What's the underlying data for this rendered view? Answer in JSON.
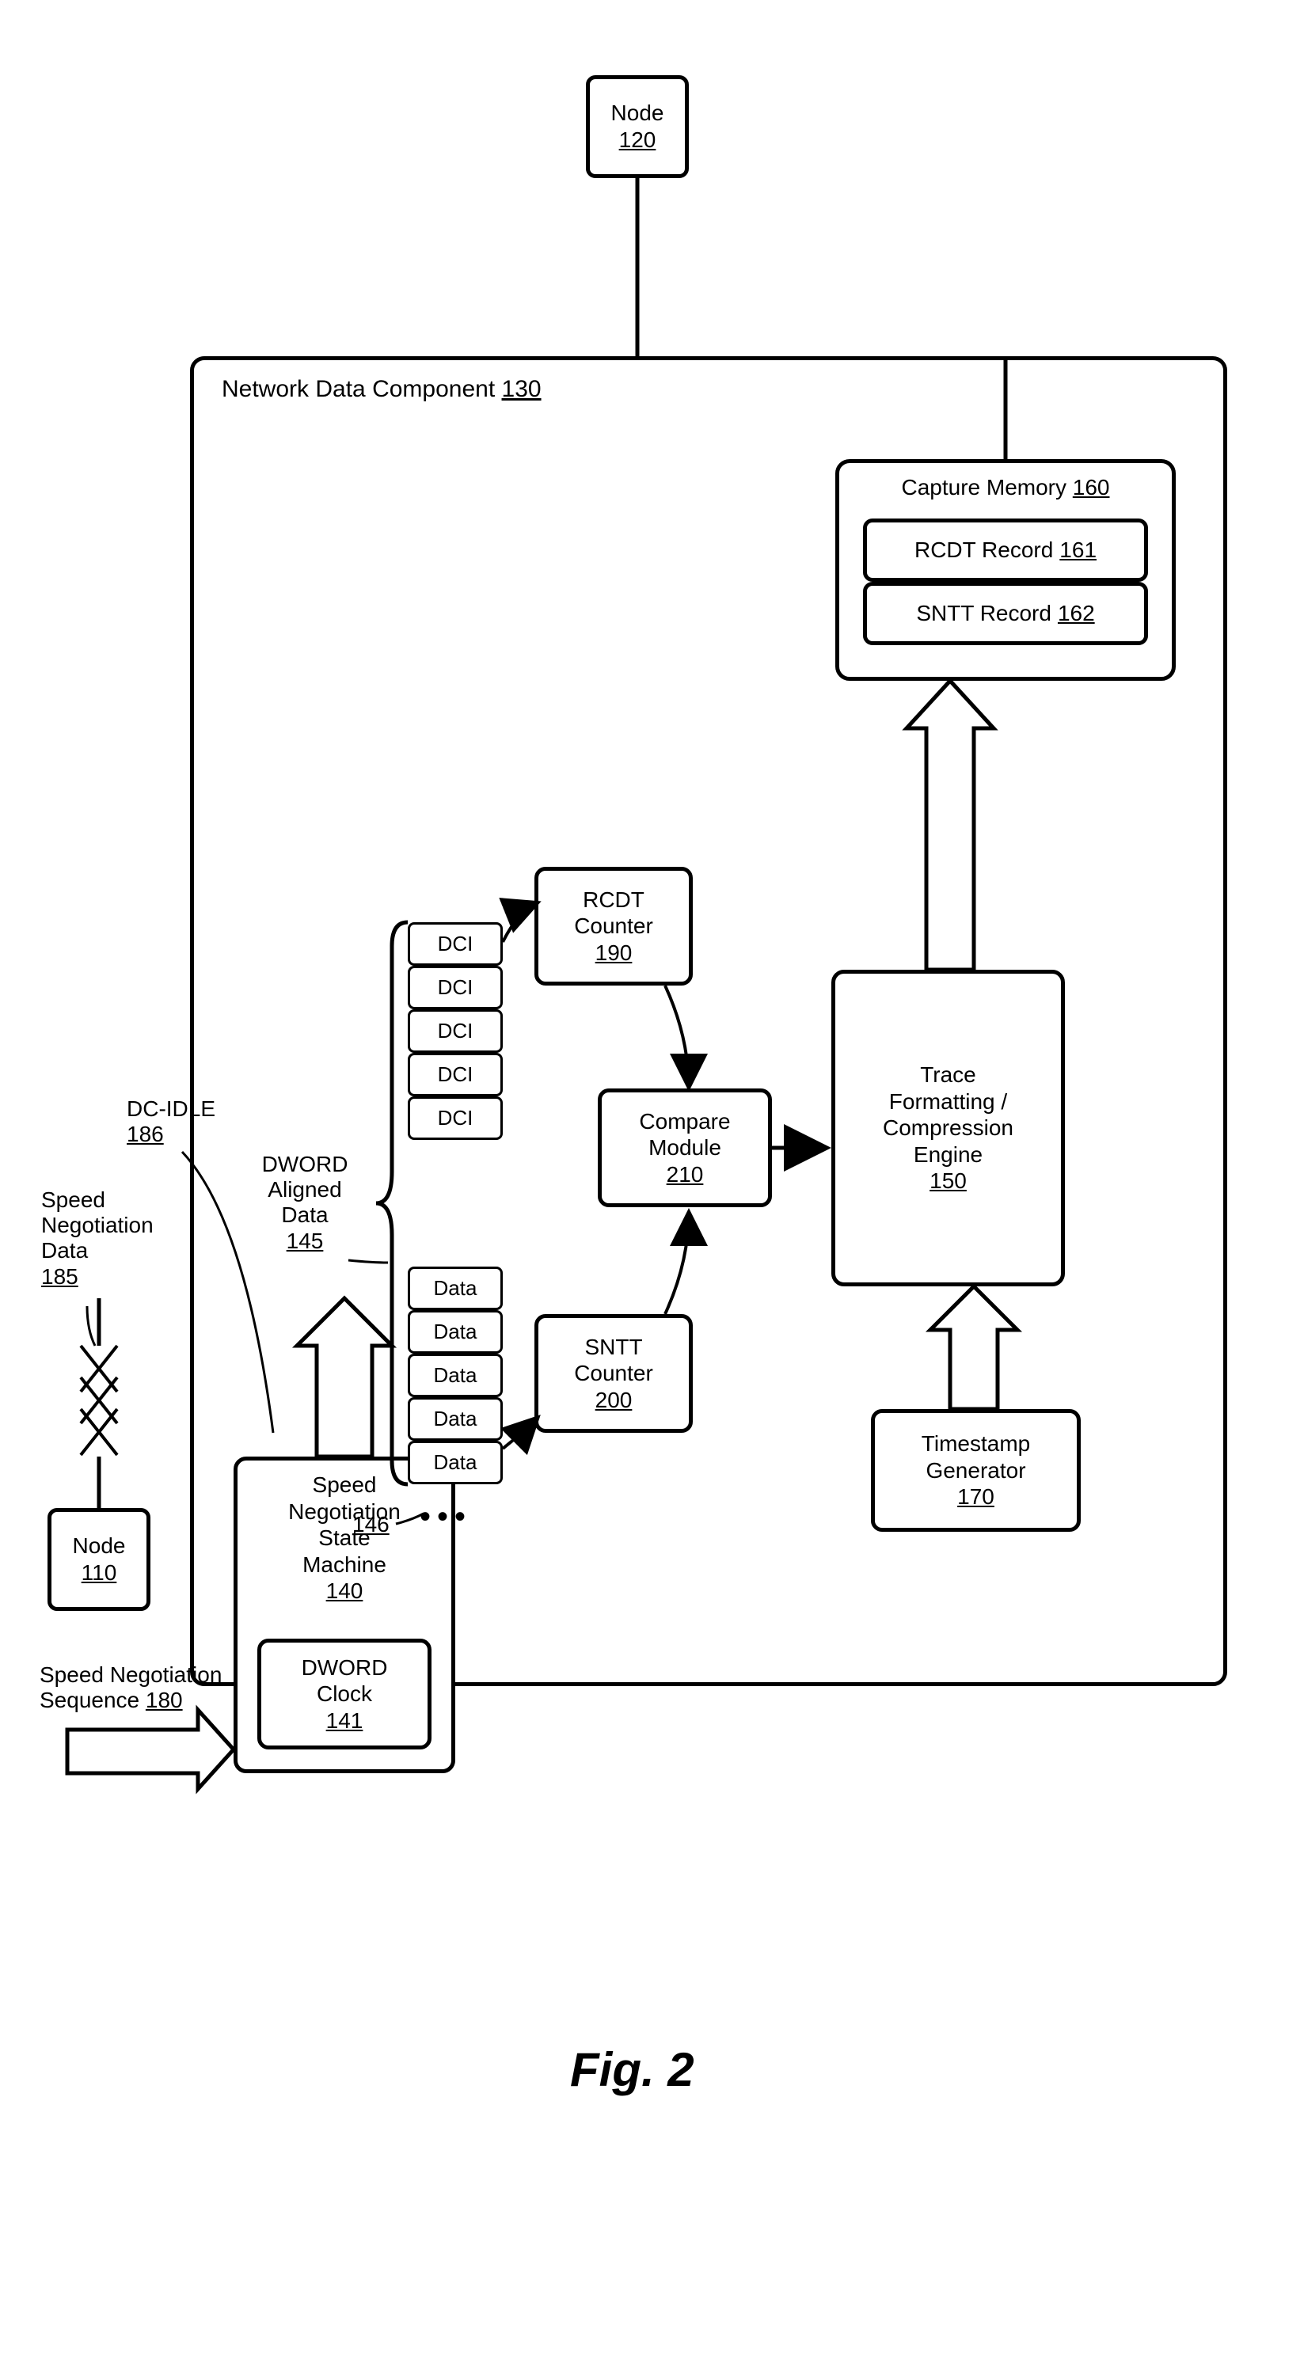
{
  "fig": "Fig. 2",
  "node110": {
    "label": "Node",
    "num": "110"
  },
  "node120": {
    "label": "Node",
    "num": "120"
  },
  "ndc": {
    "label": "Network Data Component",
    "num": "130"
  },
  "snsm": {
    "label1": "Speed",
    "label2": "Negotiation",
    "label3": "State",
    "label4": "Machine",
    "num": "140"
  },
  "dwordclock": {
    "label1": "DWORD",
    "label2": "Clock",
    "num": "141"
  },
  "dwordAligned": {
    "label1": "DWORD",
    "label2": "Aligned",
    "label3": "Data",
    "num": "145"
  },
  "dots146": "146",
  "dci": "DCI",
  "data": "Data",
  "rcdtCounter": {
    "label1": "RCDT",
    "label2": "Counter",
    "num": "190"
  },
  "snttCounter": {
    "label1": "SNTT",
    "label2": "Counter",
    "num": "200"
  },
  "compare": {
    "label1": "Compare",
    "label2": "Module",
    "num": "210"
  },
  "trace": {
    "label1": "Trace",
    "label2": "Formatting /",
    "label3": "Compression",
    "label4": "Engine",
    "num": "150"
  },
  "timestamp": {
    "label1": "Timestamp",
    "label2": "Generator",
    "num": "170"
  },
  "capture": {
    "label": "Capture Memory",
    "num": "160"
  },
  "rcdtRecord": {
    "label": "RCDT Record",
    "num": "161"
  },
  "snttRecord": {
    "label": "SNTT Record",
    "num": "162"
  },
  "speedNegData": {
    "label1": "Speed",
    "label2": "Negotiation",
    "label3": "Data",
    "num": "185"
  },
  "dcIdle": {
    "label": "DC-IDLE",
    "num": "186"
  },
  "speedNegSeq": {
    "label1": "Speed Negotiation",
    "label2": "Sequence",
    "num": "180"
  }
}
